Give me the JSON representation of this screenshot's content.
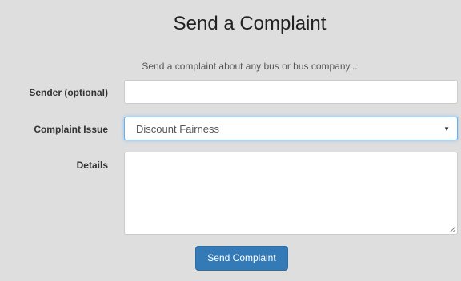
{
  "page": {
    "title": "Send a Complaint",
    "subtitle": "Send a complaint about any bus or bus company..."
  },
  "form": {
    "sender": {
      "label": "Sender (optional)",
      "value": "",
      "placeholder": ""
    },
    "issue": {
      "label": "Complaint Issue",
      "selected": "Discount Fairness",
      "icon": "chevron-down-icon"
    },
    "details": {
      "label": "Details",
      "value": "",
      "icon": "resize-grip-icon"
    },
    "submit_label": "Send Complaint"
  },
  "colors": {
    "background": "#dedede",
    "button": "#337ab7",
    "focus_border": "#66afe9"
  }
}
